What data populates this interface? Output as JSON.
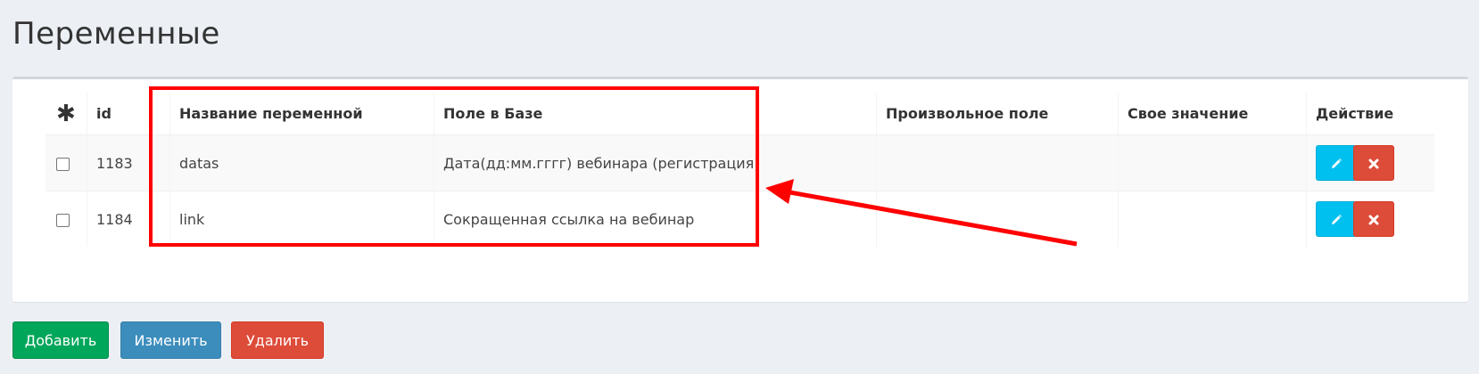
{
  "page": {
    "title": "Переменные"
  },
  "table": {
    "headers": {
      "select_all": "✱",
      "id": "id",
      "name": "Название переменной",
      "field": "Поле в Базе",
      "custom": "Произвольное поле",
      "own": "Свое значение",
      "action": "Действие"
    },
    "rows": [
      {
        "id": "1183",
        "name": "datas",
        "field": "Дата(дд:мм.гггг) вебинара (регистрация)",
        "custom": "",
        "own": ""
      },
      {
        "id": "1184",
        "name": "link",
        "field": "Сокращенная ссылка на вебинар",
        "custom": "",
        "own": ""
      }
    ]
  },
  "buttons": {
    "add": "Добавить",
    "change": "Изменить",
    "delete": "Удалить"
  },
  "icons": {
    "edit": "pencil-icon",
    "remove": "close-icon"
  },
  "colors": {
    "add": "#00a65a",
    "change": "#3c8dbc",
    "delete": "#dd4b39",
    "edit": "#00c0ef",
    "annotation": "#ff0000"
  }
}
